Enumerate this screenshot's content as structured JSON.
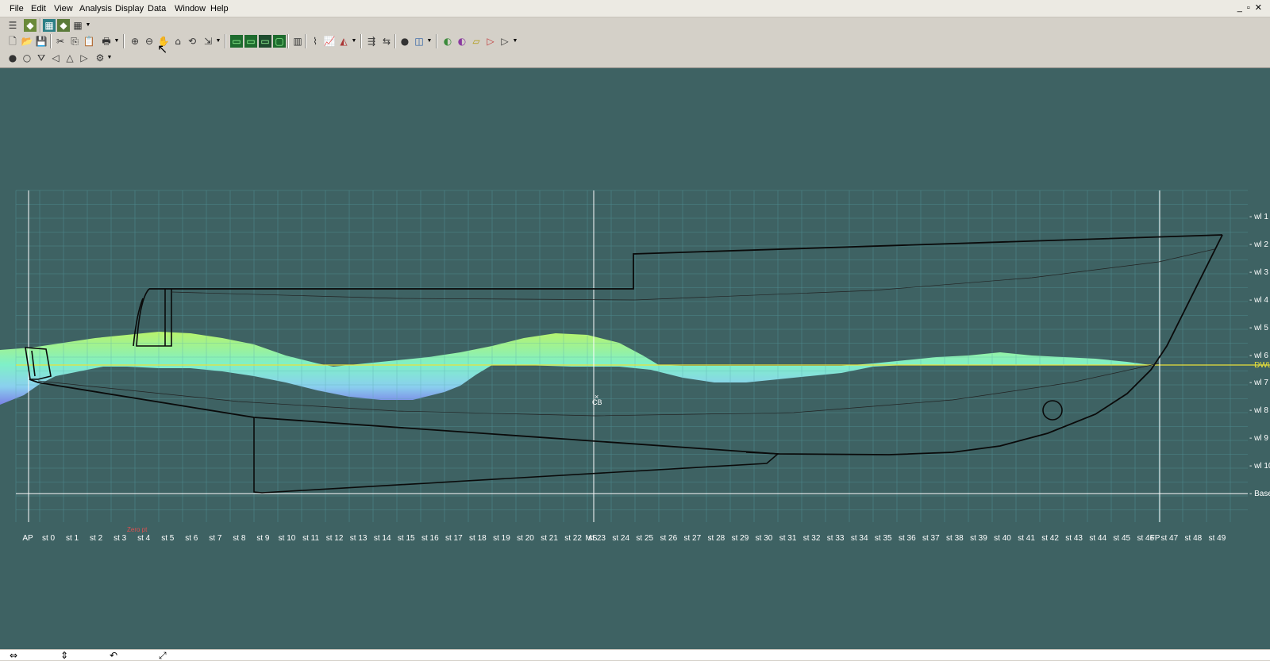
{
  "menu": [
    "File",
    "Edit",
    "View",
    "Analysis",
    "Display",
    "Data",
    "Window",
    "Help"
  ],
  "window_controls": [
    "_",
    "▫",
    "✕"
  ],
  "toolbar1_icons": [
    "layers-icon",
    "render-icon",
    "grid-icon",
    "render2-icon",
    "table-icon"
  ],
  "toolbar2_icons": [
    "new-file-icon",
    "open-icon",
    "save-icon",
    "cut-icon",
    "copy-icon",
    "paste-icon",
    "print-icon",
    "zoom-in-icon",
    "zoom-out-icon",
    "pan-hand-icon",
    "home-icon",
    "rotate-icon",
    "shear-icon",
    "view-profile-icon",
    "view-plan-icon",
    "view-body-icon",
    "view-perspective-icon",
    "table-icon",
    "curvature-icon",
    "graph-icon",
    "area-icon",
    "fit-icon",
    "measure-icon",
    "record-icon",
    "render-icon",
    "surface-green-icon",
    "surface-purple-icon",
    "surface-yellow-icon",
    "surface-red-icon",
    "surface-outline-icon"
  ],
  "toolbar3_icons": [
    "circle-filled-icon",
    "circle-empty-icon",
    "funnel-icon",
    "arrow-left-icon",
    "triangle-icon",
    "arrow-right-icon",
    "wrench-icon"
  ],
  "stations": [
    "AP",
    "st 0",
    "st 1",
    "st 2",
    "st 3",
    "st 4",
    "st 5",
    "st 6",
    "st 7",
    "st 8",
    "st 9",
    "st 10",
    "st 11",
    "st 12",
    "st 13",
    "st 14",
    "st 15",
    "st 16",
    "st 17",
    "st 18",
    "st 19",
    "st 20",
    "st 21",
    "st 22",
    "MS",
    "st 23",
    "st 24",
    "st 25",
    "st 26",
    "st 27",
    "st 28",
    "st 29",
    "st 30",
    "st 31",
    "st 32",
    "st 33",
    "st 34",
    "st 35",
    "st 36",
    "st 37",
    "st 38",
    "st 39",
    "st 40",
    "st 41",
    "st 42",
    "st 43",
    "st 44",
    "st 45",
    "st 46",
    "FP",
    "st 47",
    "st 48",
    "st 49"
  ],
  "waterlines": [
    "wl 1",
    "wl 2",
    "wl 3",
    "wl 4",
    "wl 5",
    "wl 6",
    "DWL",
    "wl 7",
    "wl 8",
    "wl 9",
    "wl 10",
    "Basel"
  ],
  "markers": {
    "cb": "CB",
    "zero": "Zero pt"
  },
  "colors": {
    "background": "#3e6263",
    "grid": "#5aa7ad",
    "hull": "#0a0a0a",
    "dwl": "#e8e03a",
    "wave_top": "#b8f36b",
    "wave_bottom": "#7a82e6",
    "ref_lines": "#ffffff"
  },
  "statusbar_icons": [
    "pan-horizontal-icon",
    "pan-vertical-icon",
    "rotate-icon",
    "fit-view-icon"
  ]
}
